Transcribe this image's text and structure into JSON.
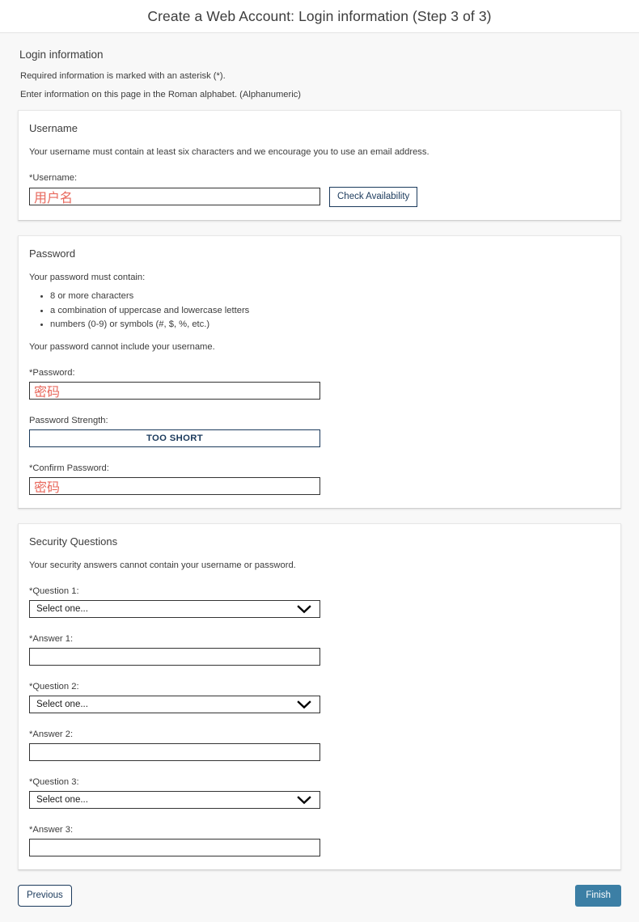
{
  "header": {
    "title": "Create a Web Account: Login information (Step 3 of 3)"
  },
  "page": {
    "section_title": "Login information",
    "intro_required": "Required information is marked with an asterisk (*).",
    "intro_alphabet": "Enter information on this page in the Roman alphabet. (Alphanumeric)"
  },
  "username_card": {
    "title": "Username",
    "description": "Your username must contain at least six characters and we encourage you to use an email address.",
    "label": "*Username:",
    "value": "用户名",
    "placeholder": "",
    "check_button": "Check Availability"
  },
  "password_card": {
    "title": "Password",
    "must_contain_label": "Your password must contain:",
    "requirements": [
      "8 or more characters",
      "a combination of uppercase and lowercase letters",
      "numbers (0-9) or symbols (#, $, %, etc.)"
    ],
    "cannot_include": "Your password cannot include your username.",
    "password_label": "*Password:",
    "password_value": "密码",
    "strength_label": "Password Strength:",
    "strength_value": "TOO SHORT",
    "confirm_label": "*Confirm Password:",
    "confirm_value": "密码"
  },
  "security_card": {
    "title": "Security Questions",
    "description": "Your security answers cannot contain your username or password.",
    "items": [
      {
        "question_label": "*Question 1:",
        "question_value": "Select one...",
        "answer_label": "*Answer 1:",
        "answer_value": ""
      },
      {
        "question_label": "*Question 2:",
        "question_value": "Select one...",
        "answer_label": "*Answer 2:",
        "answer_value": ""
      },
      {
        "question_label": "*Question 3:",
        "question_value": "Select one...",
        "answer_label": "*Answer 3:",
        "answer_value": ""
      }
    ]
  },
  "footer": {
    "previous_label": "Previous",
    "finish_label": "Finish"
  },
  "colors": {
    "page_background": "#f8f8f8",
    "card_background": "#ffffff",
    "accent_navy": "#1b3a5c",
    "finish_button": "#3c7fa5",
    "entered_text": "#e8685c",
    "input_border": "#333333"
  }
}
